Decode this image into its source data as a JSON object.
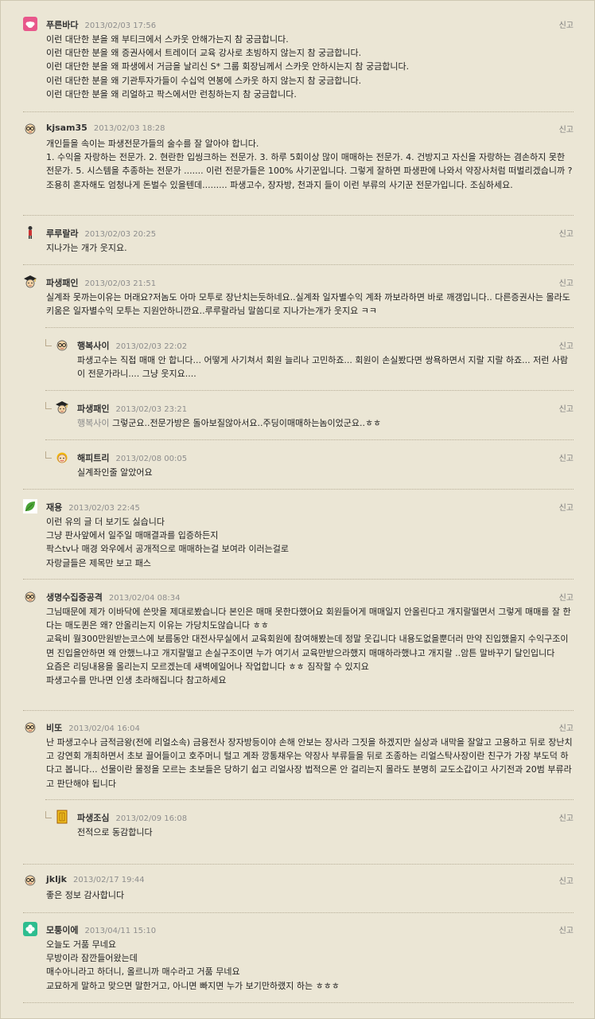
{
  "report_label": "신고",
  "comments": [
    {
      "nick": "푸른바다",
      "date": "2013/02/03 17:56",
      "avatar": "pink-cloud-avatar",
      "lines": [
        "이런 대단한 분을 왜 부티크에서 스카웃 안해가는지 참 궁금합니다.",
        "이런 대단한 분을 왜 증권사에서 트레이더 교육 강사로 초빙하지 않는지 참 궁금합니다.",
        "이런 대단한 분을 왜 파생에서 거금을 날리신 S* 그룹 회장님께서 스카웃 안하시는지 참 궁금합니다.",
        "이런 대단한 분을 왜 기관투자가들이 수십억 연봉에 스카웃 하지 않는지 참 궁금합니다.",
        "이런 대단한 분을 왜 리얼하고 팍스에서만 런칭하는지 참 궁금합니다."
      ]
    },
    {
      "nick": "kjsam35",
      "date": "2013/02/03 18:28",
      "avatar": "glasses-face-avatar",
      "lines": [
        "개인들을 속이는 파생전문가들의 술수를 잘 알아야 합니다.",
        "1. 수익을 자랑하는 전문가. 2. 현란한 입씽크하는 전문가. 3. 하루 5회이상 많이 매매하는 전문가. 4. 건방지고 자신을 자랑하는 겸손하지 못한 전문가. 5. 시스템을 추종하는 전문가 ....... 이런 전문가들은 100% 사기꾼입니다. 그렇게 잘하면 파생판에 나와서 약장사처럼 떠벌리겠습니까 ? 조용히 혼자해도 엄청나게 돈벌수 있을텐데......... 파생고수, 장자방, 천과지 들이 이런 부류의 사기꾼 전문가입니다. 조심하세요."
      ]
    },
    {
      "nick": "루루랄라",
      "date": "2013/02/03 20:25",
      "avatar": "tiny-figure-avatar",
      "lines": [
        "지나가는 개가 웃지요."
      ]
    },
    {
      "nick": "파생패인",
      "date": "2013/02/03 21:51",
      "avatar": "graduate-cap-avatar",
      "lines": [
        "실계좌 못까는이유는 머래요?저놈도 아마 모투로 장난치는듯하네요..실계좌 일자별수익 계좌 까보라하면 바로 깨갱입니다.. 다른증권사는 몰라도 키움은 일자별수익 모투는 지원안하니깐요..루루랄라님 말씀디로 지나가는개가 웃지요 ㅋㅋ"
      ]
    },
    {
      "nick": "행복사이",
      "date": "2013/02/03 22:02",
      "avatar": "glasses-face-avatar",
      "reply": true,
      "lines": [
        "파생고수는 직접 매매 안 합니다... 어떻게 사기쳐서 회원 늘리나 고민하죠... 회원이 손실봤다면 쌍욕하면서 지랄 지랄 하죠... 저런 사람이 전문가라니.... 그냥 웃지요...."
      ]
    },
    {
      "nick": "파생패인",
      "date": "2013/02/03 23:21",
      "avatar": "graduate-cap-avatar",
      "reply": true,
      "mention": "행복사이",
      "lines": [
        "그렇군요..전문가방은 돌아보질않아서요..주딩이매매하는놈이었군요..ㅎㅎ"
      ]
    },
    {
      "nick": "해피트리",
      "date": "2013/02/08 00:05",
      "avatar": "blonde-face-avatar",
      "reply": true,
      "lines": [
        "실계좌인줄 알았어요"
      ]
    },
    {
      "nick": "재용",
      "date": "2013/02/03 22:45",
      "avatar": "green-leaf-avatar",
      "lines": [
        "이런 유의 글 더 보기도 싫습니다",
        "그냥 판사앞에서 일주일 매매결과를 입증하든지",
        "팍스tv나 매경 와우에서 공개적으로 매매하는걸 보여라 이러는걸로",
        "자랑글들은 제목만 보고 패스"
      ]
    },
    {
      "nick": "생명수집중공격",
      "date": "2013/02/04 08:34",
      "avatar": "glasses-face-avatar",
      "lines": [
        "그님때문에 제가 이바닥에 쓴맛을 제대로봤습니다 본인은 매매 못한다했어요 회원들어게 매매일지 안올린다고 개지랄떨면서 그렇게 매매를 잘 한다는 매도퀸은 왜? 안올리는지 이유는 가당치도않습니다 ㅎㅎ",
        "교육비 월300만원받는코스에 보름동안 대전사무실에서 교육회원에 참여해봤는데 정말 웃깁니다 내용도없을뿐더러 만약 진입했을지 수익구조이면 진입을안하면 왜 안했느냐고 개지랄떨고 손실구조이면 누가 여기서 교육만받으라했지 매매하라했냐고 개지랄 ..암튼 말바꾸기 달인입니다",
        "요즘은 리딩내용을 올리는지 모르겠는데 새벽에일어나 작업합니다 ㅎㅎ 짐작할 수 있지요",
        "파생고수를 만나면 인생 초라해집니다 참고하세요"
      ]
    },
    {
      "nick": "비또",
      "date": "2013/02/04 16:04",
      "avatar": "glasses-face-avatar",
      "lines": [
        "난 파생고수나 금적금왕(전에 리얼소속) 금융전사 장자방등이야 손해 안보는 장사라 그짓을 하겠지만 실상과 내막을 잘알고 고용하고 뒤로 장난치고 강연회 개최하면서 초보 끌어들이고 호주머니 털고 계좌 깡통채우는 약장사 부류들을 뒤로 조종하는 리얼스탁사장이란 친구가 가장 부도덕 하다고 봅니다... 선물이란 물정을 모르는 초보들은 당하기 쉽고 리얼사장 법적으론 안 걸리는지 몰라도 분명히 교도소갑이고 사기전과 20범 부류라고 판단해야 됩니다"
      ]
    },
    {
      "nick": "파생조심",
      "date": "2013/02/09 16:08",
      "avatar": "yellow-scroll-avatar",
      "reply": true,
      "lines": [
        "전적으로 동감합니다"
      ]
    },
    {
      "nick": "jkljk",
      "date": "2013/02/17 19:44",
      "avatar": "glasses-face-avatar",
      "lines": [
        "좋은 정보 감사합니다"
      ]
    },
    {
      "nick": "모퉁이에",
      "date": "2013/04/11 15:10",
      "avatar": "clover-avatar",
      "lines": [
        "오늘도 거품 무네요",
        "무방이라 잠깐들어왔는데",
        "매수아니라고 하더니, 올르니까 매수라고 거품 무네요",
        "교묘하게 말하고 맞으면 말한거고, 아니면 빠지면 누가 보기만하랬지 하는 ㅎㅎㅎ"
      ]
    }
  ]
}
